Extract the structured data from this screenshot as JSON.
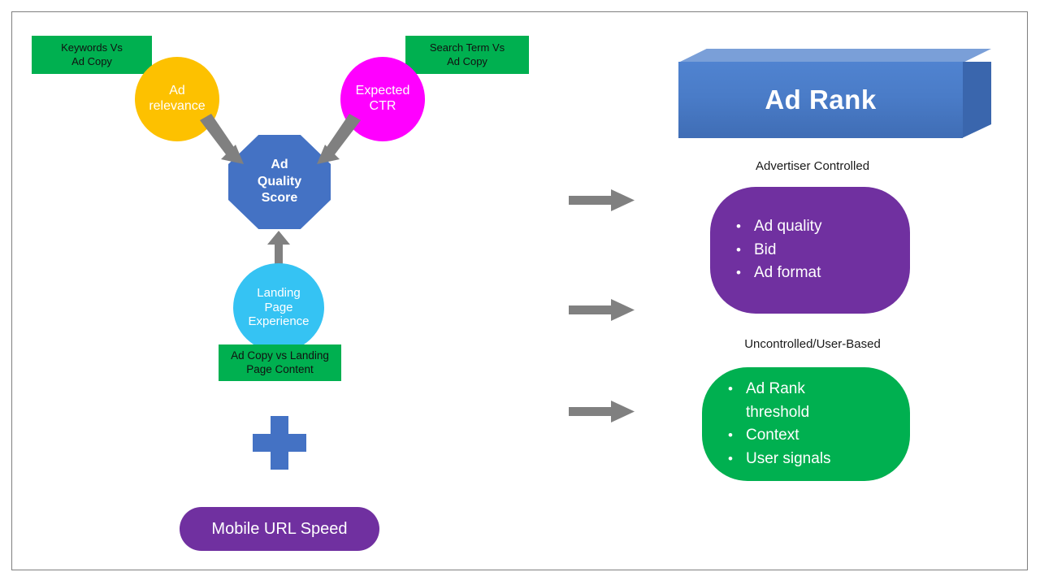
{
  "diagram": {
    "title_shape": {
      "label": "Ad Rank"
    },
    "inputs": [
      {
        "name": "keywords-vs-ad-copy",
        "label": "Keywords  Vs\nAd Copy",
        "color": "#00B050"
      },
      {
        "name": "search-term-vs-ad-copy",
        "label": "Search Term  Vs\nAd Copy",
        "color": "#00B050"
      },
      {
        "name": "ad-copy-vs-landing-page-content",
        "label": "Ad Copy vs Landing\nPage Content",
        "color": "#00B050"
      }
    ],
    "factors": [
      {
        "name": "ad-relevance",
        "label": "Ad\nrelevance",
        "color": "#FDC100"
      },
      {
        "name": "expected-ctr",
        "label": "Expected\nCTR",
        "color": "#FF00FF"
      },
      {
        "name": "landing-page-experience",
        "label": "Landing\nPage\nExperience",
        "color": "#35C3F3"
      }
    ],
    "quality_score": {
      "label": "Ad\nQuality\nScore",
      "color": "#4472C4"
    },
    "plus": {
      "label": "plus-sign",
      "color": "#4472C4"
    },
    "mobile_speed": {
      "label": "Mobile URL Speed",
      "color": "#7030A0"
    },
    "right_column": {
      "captions": [
        "Advertiser Controlled",
        "Uncontrolled/User-Based"
      ],
      "advertiser_panel": {
        "color": "#7030A0",
        "bullet": "•",
        "items": [
          "Ad quality",
          "Bid",
          "Ad format"
        ]
      },
      "uncontrolled_panel": {
        "color": "#00B050",
        "bullet": "•",
        "items": [
          "Ad Rank\nthreshold",
          "Context",
          "User signals"
        ]
      }
    },
    "arrows": {
      "color": "#808080",
      "count": 3
    }
  }
}
